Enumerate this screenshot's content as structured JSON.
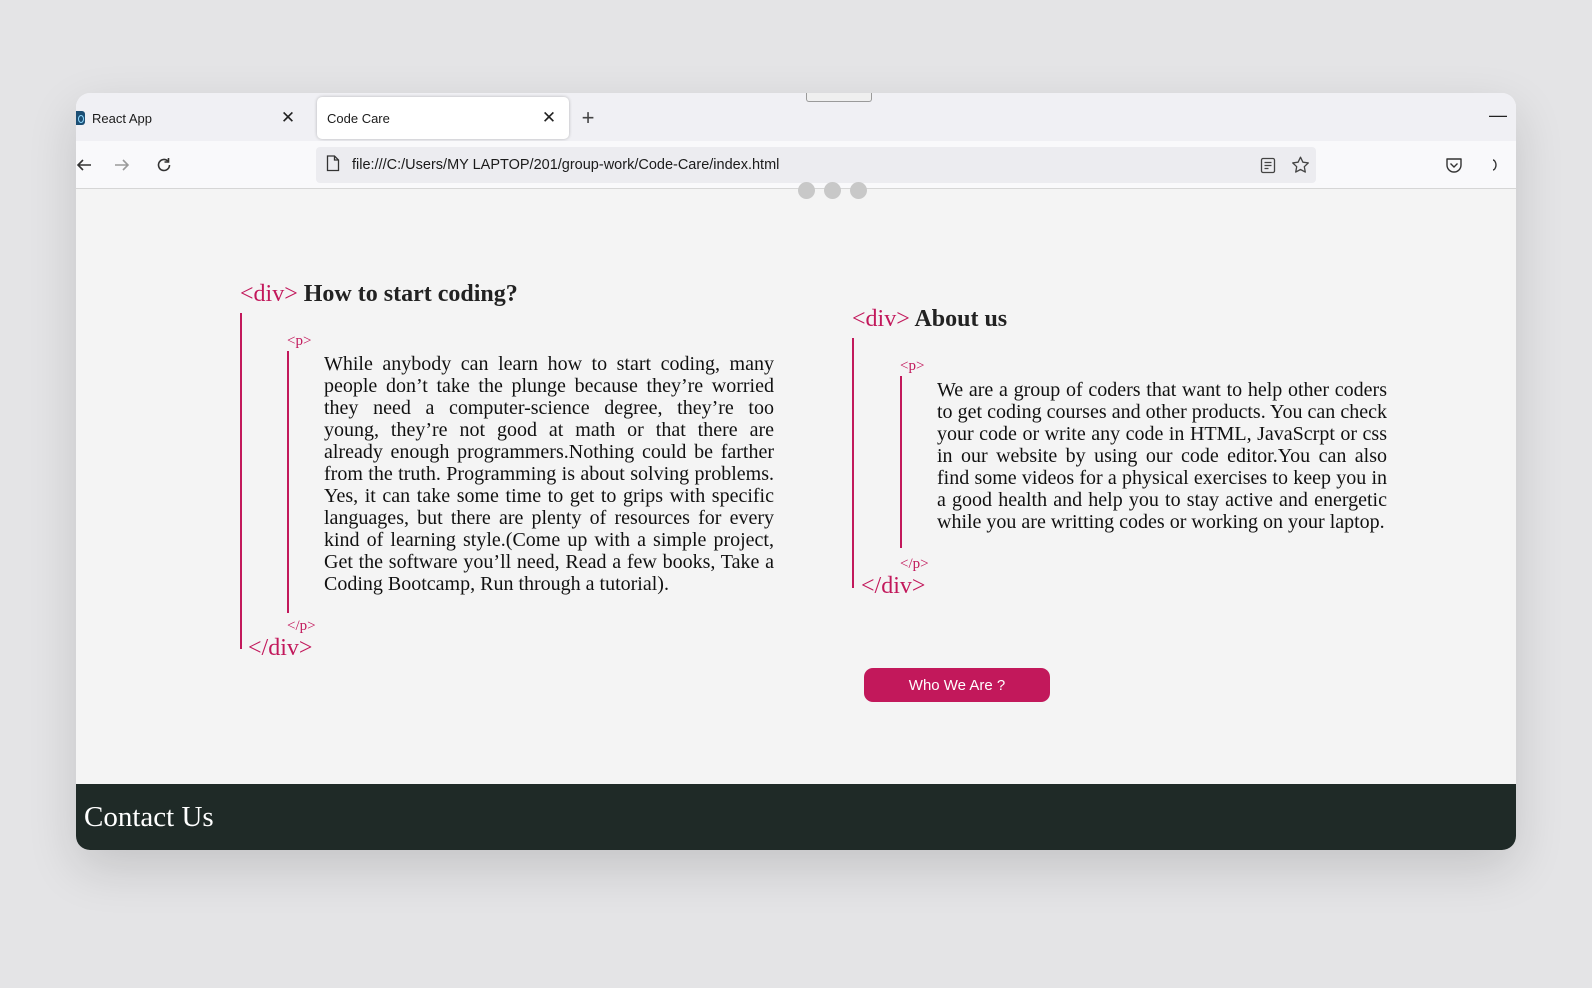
{
  "browser": {
    "tabs": [
      {
        "title": "React App",
        "close": "✕"
      },
      {
        "title": "Code Care",
        "close": "✕"
      }
    ],
    "new_tab": "+",
    "minimize": "—",
    "url": "file:///C:/Users/MY LAPTOP/201/group-work/Code-Care/index.html"
  },
  "section_left": {
    "open_div": "<div>",
    "title": "How to start coding?",
    "open_p": "<p>",
    "text": "While anybody can learn how to start coding, many people don’t take the plunge because they’re worried they need a computer-science degree, they’re too young, they’re not good at math or that there are already enough programmers.Nothing could be farther from the truth. Programming is about solving problems. Yes, it can take some time to get to grips with specific languages, but there are plenty of resources for every kind of learning style.(Come up with a simple project, Get the software you’ll need, Read a few books, Take a Coding Bootcamp, Run through a tutorial).",
    "close_p": "</p>",
    "close_div": "</div>"
  },
  "section_right": {
    "open_div": "<div>",
    "title": "About us",
    "open_p": "<p>",
    "text": "We are a group of coders that want to help other coders to get coding courses and other products. You can check your code or write any code in HTML, JavaScrpt or css in our website by using our code editor.You can also find some videos for a physical exercises to keep you in a good health and help you to stay active and energetic while you are writting codes or working on your laptop.",
    "close_p": "</p>",
    "close_div": "</div>"
  },
  "who_button": "Who We Are ?",
  "footer": {
    "title": "Contact Us"
  }
}
